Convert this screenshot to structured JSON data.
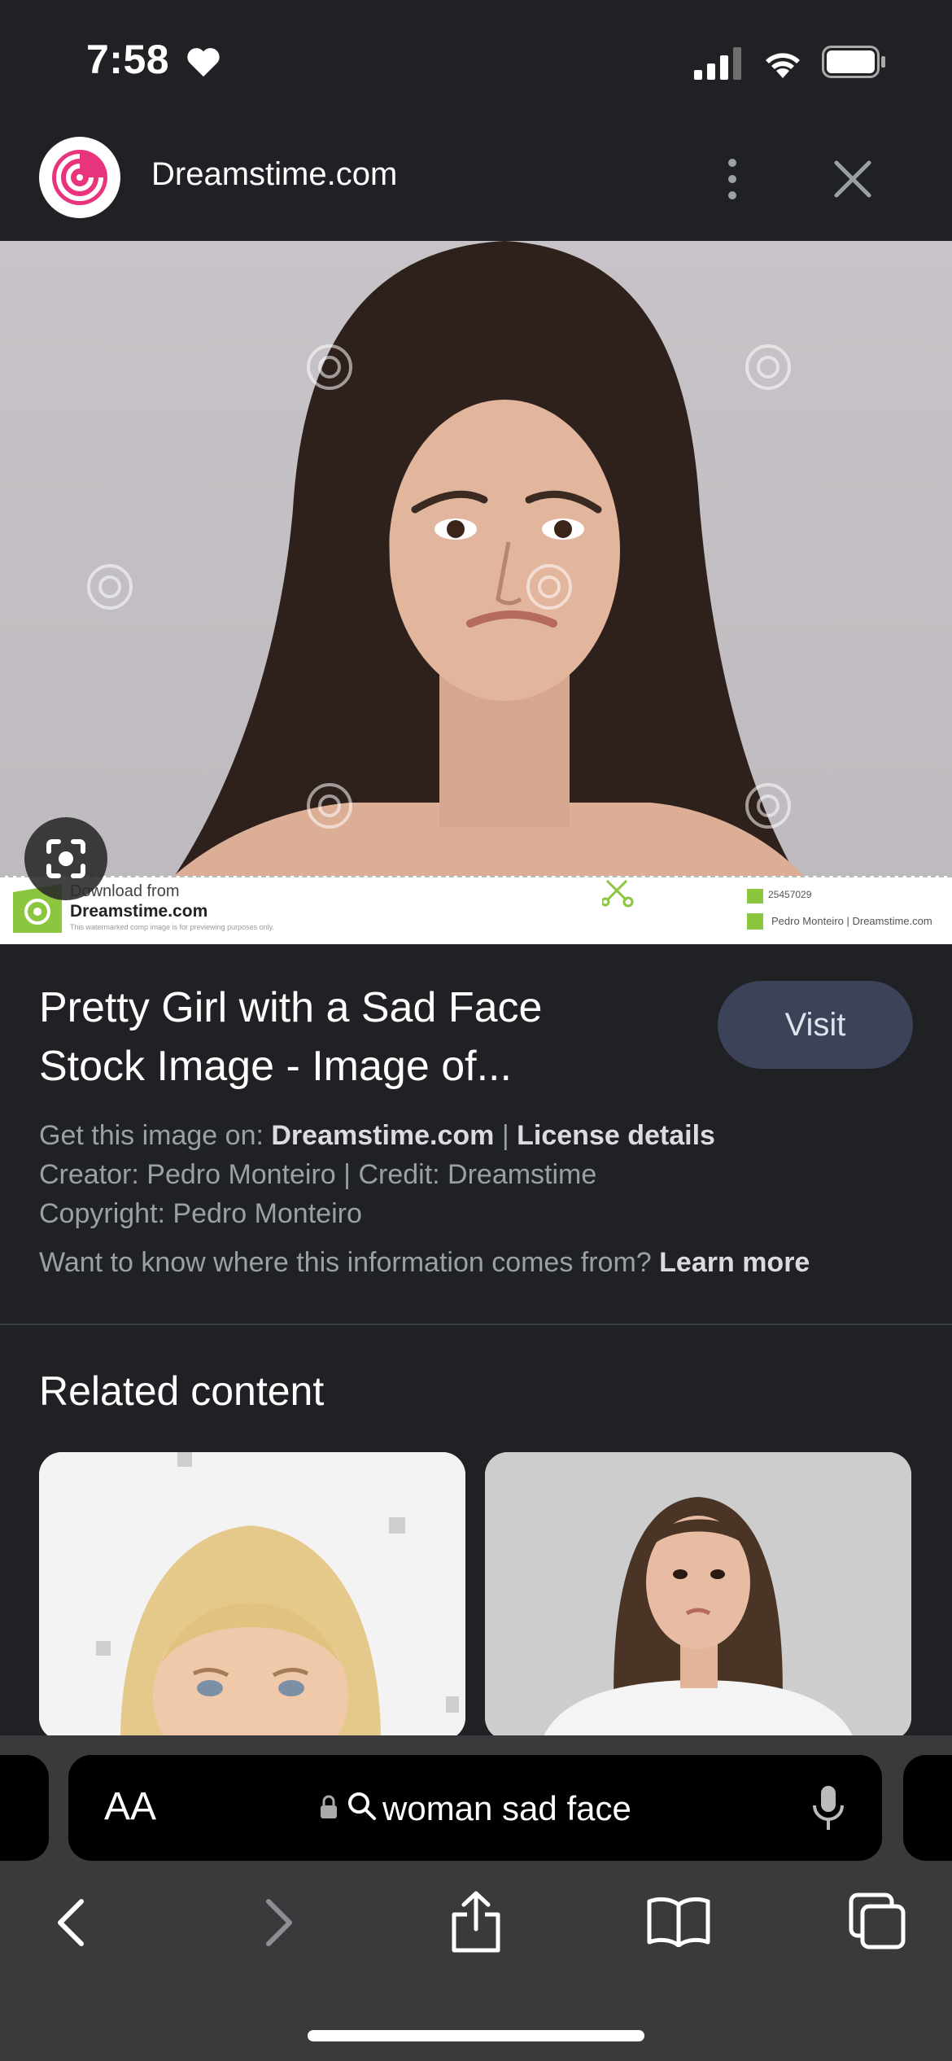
{
  "status": {
    "time": "7:58"
  },
  "header": {
    "site_name": "Dreamstime.com"
  },
  "image": {
    "wm_download": "Download from",
    "wm_brand": "Dreamstime.com",
    "wm_small": "This watermarked comp image is for previewing purposes only.",
    "wm_id": "25457029",
    "wm_credit": "Pedro Monteiro | Dreamstime.com"
  },
  "details": {
    "title_line1": "Pretty Girl with a Sad Face",
    "title_line2": "Stock Image - Image of...",
    "visit_label": "Visit",
    "get_prefix": "Get this image on:",
    "get_site": "Dreamstime.com",
    "get_sep": "|",
    "license": "License details",
    "creator_line": "Creator: Pedro Monteiro | Credit: Dreamstime",
    "copyright_line": "Copyright: Pedro Monteiro",
    "info_question": "Want to know where this information comes from?",
    "learn_more": "Learn more"
  },
  "related": {
    "title": "Related content"
  },
  "browser": {
    "aa_label": "AA",
    "url_text": "woman sad face"
  },
  "colors": {
    "background": "#202124",
    "visit_button": "#3c4257",
    "toolbar": "#3a3a3c"
  }
}
